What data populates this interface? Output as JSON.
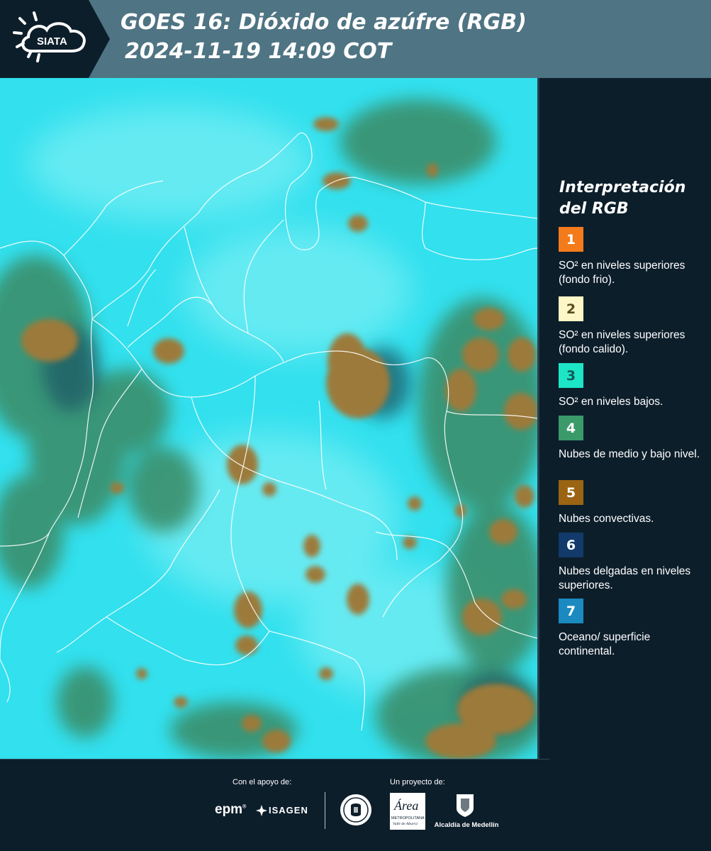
{
  "header": {
    "logo_text": "SIATA",
    "title_line1": "GOES 16: Dióxido de azúfre (RGB)",
    "title_line2": "2024-11-19 14:09 COT"
  },
  "legend": {
    "title_line1": "Interpretación",
    "title_line2": "del RGB",
    "items": [
      {
        "number": "1",
        "color": "#f47b1b",
        "text_color": "#ffffff",
        "text": "SO² en niveles superiores (fondo frio)."
      },
      {
        "number": "2",
        "color": "#fdf6c6",
        "text_color": "#5a4a1c",
        "text": "SO² en niveles superiores (fondo calido)."
      },
      {
        "number": "3",
        "color": "#1de6c6",
        "text_color": "#0e5a5a",
        "text": "SO² en niveles bajos."
      },
      {
        "number": "4",
        "color": "#3a9a6a",
        "text_color": "#ffffff",
        "text": "Nubes de medio y bajo nivel."
      },
      {
        "number": "5",
        "color": "#9a6412",
        "text_color": "#ffffff",
        "text": "Nubes convectivas."
      },
      {
        "number": "6",
        "color": "#123a6a",
        "text_color": "#ffffff",
        "text": "Nubes delgadas en niveles superiores."
      },
      {
        "number": "7",
        "color": "#1a8ac0",
        "text_color": "#ffffff",
        "text": "Oceano/ superficie continental."
      }
    ]
  },
  "footer": {
    "support_caption": "Con el apoyo de:",
    "project_caption": "Un proyecto de:",
    "epm_logo": "epm",
    "isagen_logo": "ISAGEN",
    "area_logo_main": "Área",
    "area_logo_sub1": "METROPOLITANA",
    "area_logo_sub2": "Valle de Aburrá",
    "alcaldia_logo": "Alcaldía de Medellín"
  },
  "map": {
    "colors": {
      "background": "#32e0ee",
      "green_clouds": "#3b8f6c",
      "convective": "#9c7a3a",
      "dark_shadow": "#1e5a66",
      "borders": "#ffffff"
    }
  }
}
